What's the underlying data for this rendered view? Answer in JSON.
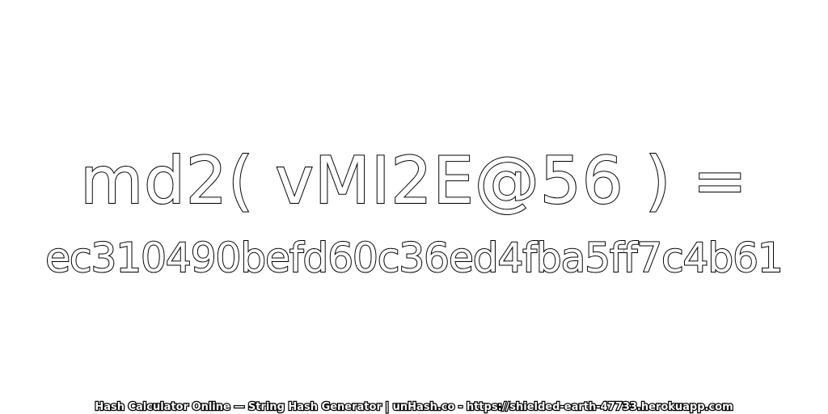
{
  "image": {
    "expression": "md2( vMI2E@56 ) =",
    "hash_value": "ec310490befd60c36ed4fba5ff7c4b61",
    "footer_text": "Hash Calculator Online — String Hash Generator | unHash.co - https://shielded-earth-47733.herokuapp.com",
    "colors": {
      "background": "#ffffff",
      "text_fill": "#ffffff",
      "text_stroke": "#000000"
    }
  }
}
